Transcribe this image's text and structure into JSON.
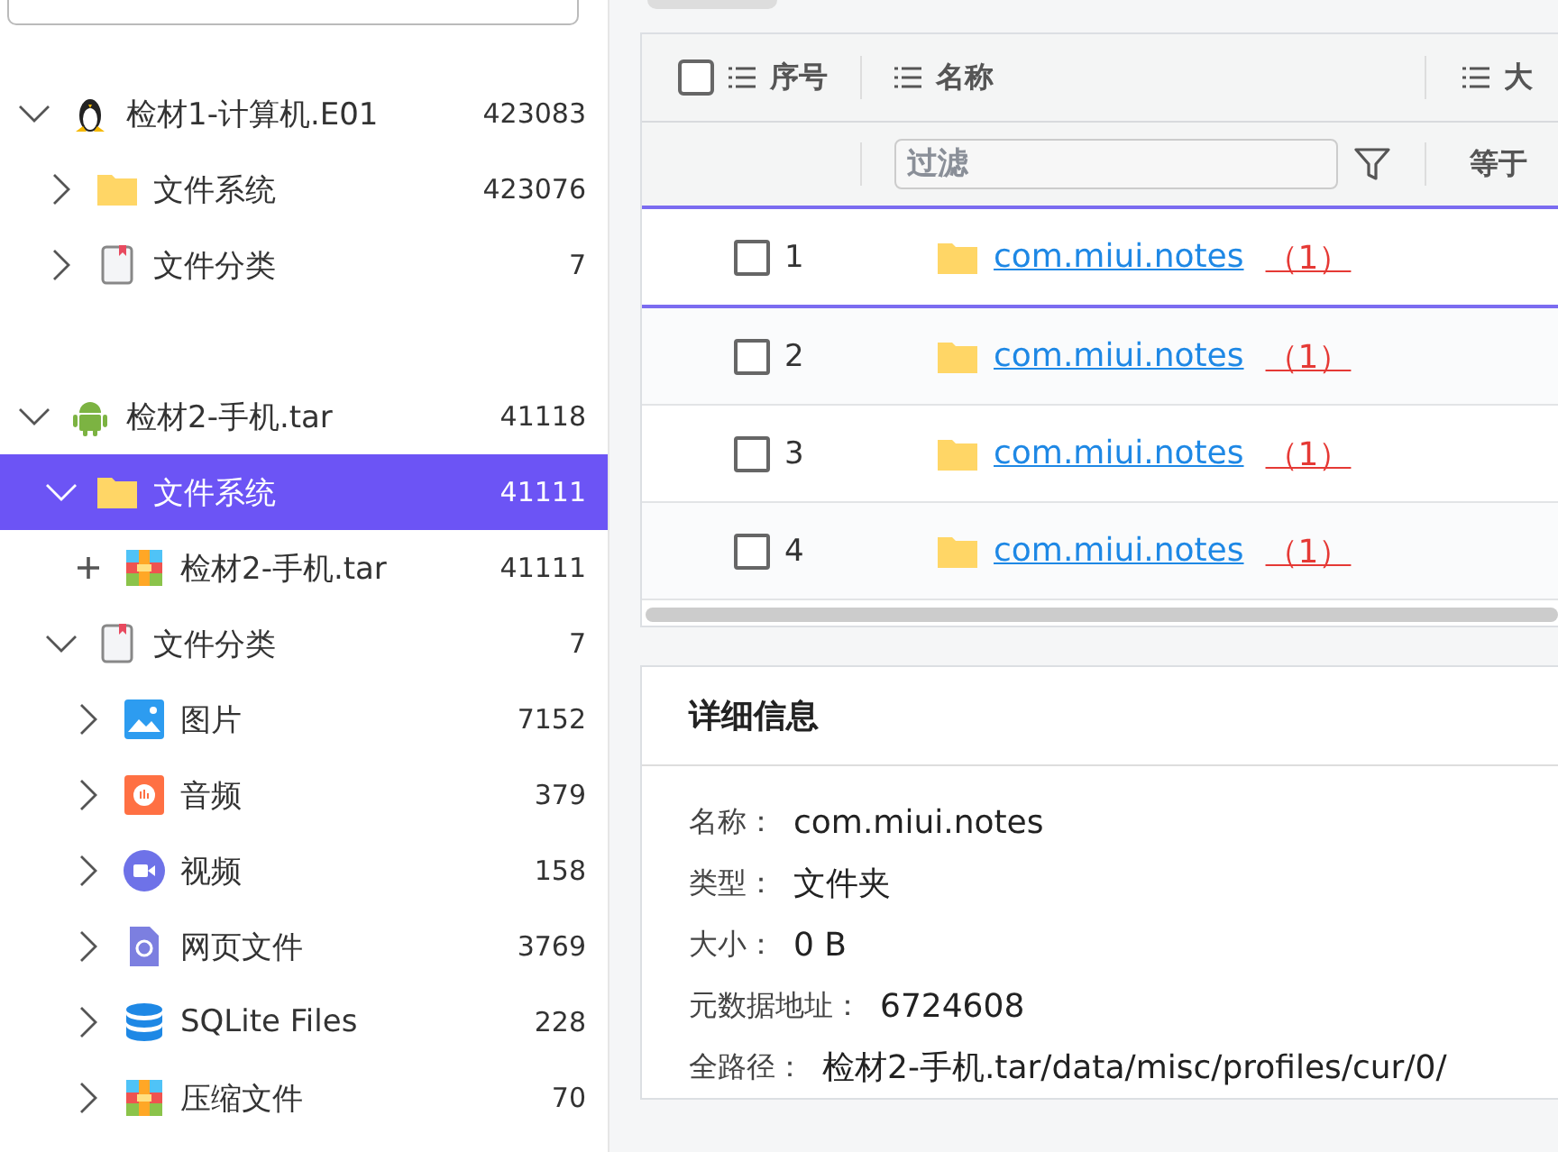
{
  "tree": [
    {
      "label": "检材1-计算机.E01",
      "count": "423083",
      "kind": "linux",
      "expanded": true,
      "selected": false,
      "children": [
        {
          "label": "文件系统",
          "count": "423076",
          "kind": "folder",
          "expanded": false,
          "selected": false
        },
        {
          "label": "文件分类",
          "count": "7",
          "kind": "document",
          "expanded": false,
          "selected": false
        }
      ]
    },
    {
      "label": "检材2-手机.tar",
      "count": "41118",
      "kind": "android",
      "expanded": true,
      "selected": false,
      "children": [
        {
          "label": "文件系统",
          "count": "41111",
          "kind": "folder",
          "expanded": true,
          "selected": true,
          "children": [
            {
              "label": "检材2-手机.tar",
              "count": "41111",
              "kind": "image",
              "expanded": false,
              "selected": false
            }
          ]
        },
        {
          "label": "文件分类",
          "count": "7",
          "kind": "document",
          "expanded": true,
          "selected": false,
          "children": [
            {
              "label": "图片",
              "count": "7152",
              "kind": "pictures",
              "expanded": false,
              "selected": false
            },
            {
              "label": "音频",
              "count": "379",
              "kind": "audio",
              "expanded": false,
              "selected": false
            },
            {
              "label": "视频",
              "count": "158",
              "kind": "video",
              "expanded": false,
              "selected": false
            },
            {
              "label": "网页文件",
              "count": "3769",
              "kind": "web",
              "expanded": false,
              "selected": false
            },
            {
              "label": "SQLite Files",
              "count": "228",
              "kind": "database",
              "expanded": false,
              "selected": false
            },
            {
              "label": "压缩文件",
              "count": "70",
              "kind": "archive",
              "expanded": false,
              "selected": false
            }
          ]
        }
      ]
    }
  ],
  "table": {
    "columns": [
      "序号",
      "名称",
      "大"
    ],
    "filter": {
      "placeholder": "过滤",
      "operator": "等于"
    },
    "select_all_checked": false,
    "rows": [
      {
        "index": "1",
        "name": "com.miui.notes",
        "count": "（1）",
        "checked": false,
        "selected": true
      },
      {
        "index": "2",
        "name": "com.miui.notes",
        "count": "（1）",
        "checked": false,
        "selected": false
      },
      {
        "index": "3",
        "name": "com.miui.notes",
        "count": "（1）",
        "checked": false,
        "selected": false
      },
      {
        "index": "4",
        "name": "com.miui.notes",
        "count": "（1）",
        "checked": false,
        "selected": false
      }
    ]
  },
  "details": {
    "title": "详细信息",
    "fields": [
      {
        "label": "名称：",
        "value": "com.miui.notes"
      },
      {
        "label": "类型：",
        "value": "文件夹"
      },
      {
        "label": "大小：",
        "value": "0 B"
      },
      {
        "label": "元数据地址：",
        "value": "6724608"
      },
      {
        "label": "全路径：",
        "value": "检材2-手机.tar/data/misc/profiles/cur/0/"
      }
    ]
  }
}
